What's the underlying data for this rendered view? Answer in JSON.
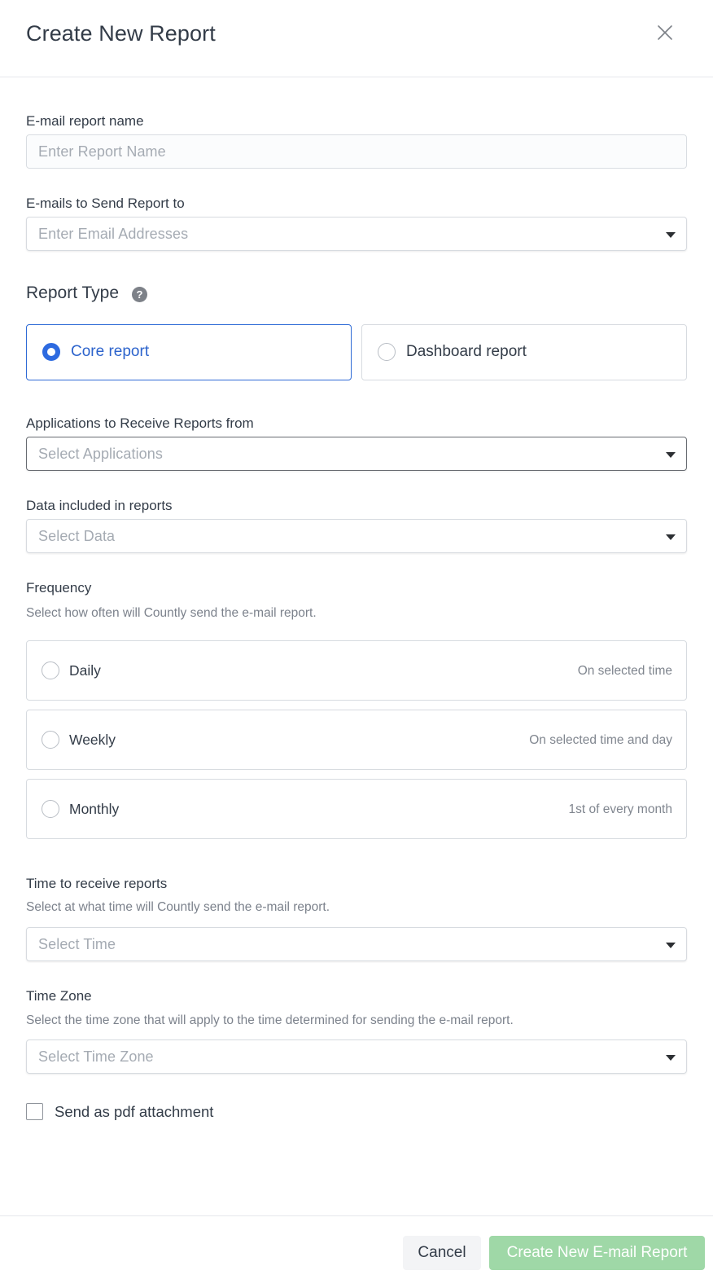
{
  "header": {
    "title": "Create New Report",
    "close_icon": "close-icon"
  },
  "report_name": {
    "label": "E-mail report name",
    "placeholder": "Enter Report Name",
    "value": ""
  },
  "emails": {
    "label": "E-mails to Send Report to",
    "placeholder": "Enter Email Addresses"
  },
  "report_type": {
    "title": "Report Type",
    "help_icon": "help-icon",
    "options": [
      {
        "label": "Core report",
        "selected": true
      },
      {
        "label": "Dashboard report",
        "selected": false
      }
    ]
  },
  "applications": {
    "label": "Applications to Receive Reports from",
    "placeholder": "Select Applications"
  },
  "data": {
    "label": "Data included in reports",
    "placeholder": "Select Data"
  },
  "frequency": {
    "label": "Frequency",
    "description": "Select how often will Countly send the e-mail report.",
    "options": [
      {
        "label": "Daily",
        "hint": "On selected time",
        "selected": false
      },
      {
        "label": "Weekly",
        "hint": "On selected time and day",
        "selected": false
      },
      {
        "label": "Monthly",
        "hint": "1st of every month",
        "selected": false
      }
    ]
  },
  "time": {
    "label": "Time to receive reports",
    "description": "Select at what time will Countly send the e-mail report.",
    "placeholder": "Select Time"
  },
  "timezone": {
    "label": "Time Zone",
    "description": "Select the time zone that will apply to the time determined for sending the e-mail report.",
    "placeholder": "Select Time Zone"
  },
  "pdf": {
    "label": "Send as pdf attachment",
    "checked": false
  },
  "footer": {
    "cancel_label": "Cancel",
    "create_label": "Create New E-mail Report"
  },
  "colors": {
    "accent": "#2d6ae0",
    "create_button": "#9fd8a7",
    "text": "#333c48",
    "muted": "#7c828c"
  }
}
